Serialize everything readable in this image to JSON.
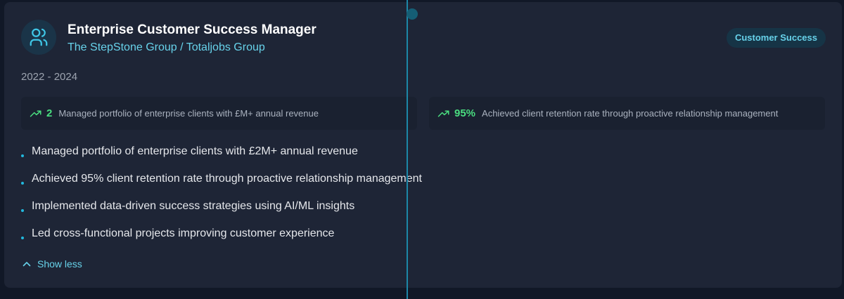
{
  "experience": {
    "title": "Enterprise Customer Success Manager",
    "company": "The StepStone Group / Totaljobs Group",
    "category": "Customer Success",
    "dates": "2022 - 2024",
    "icon": "users-icon",
    "metrics": [
      {
        "value": "2",
        "label": "Managed portfolio of enterprise clients with £M+ annual revenue",
        "icon": "trending-up-icon"
      },
      {
        "value": "95%",
        "label": "Achieved client retention rate through proactive relationship management",
        "icon": "trending-up-icon"
      }
    ],
    "highlights": [
      "Managed portfolio of enterprise clients with £2M+ annual revenue",
      "Achieved 95% client retention rate through proactive relationship management",
      "Implemented data-driven success strategies using AI/ML insights",
      "Led cross-functional projects improving customer experience"
    ],
    "toggle_label": "Show less",
    "toggle_icon": "chevron-up-icon"
  },
  "colors": {
    "page_bg": "#111827",
    "card_bg": "#1e2536",
    "accent": "#67d2ea",
    "timeline": "#1c87a8",
    "metric_value": "#4ade80"
  }
}
